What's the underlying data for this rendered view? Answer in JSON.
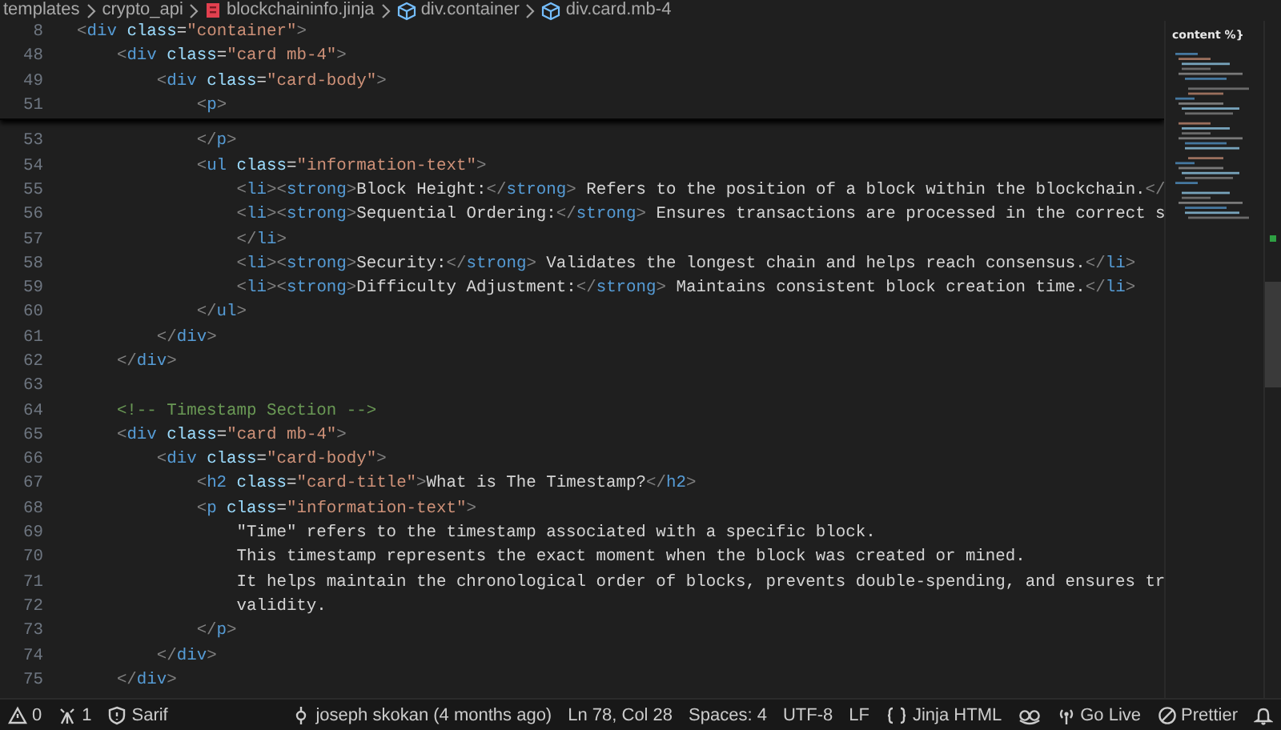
{
  "breadcrumbs": [
    {
      "text": "templates"
    },
    {
      "text": "crypto_api"
    },
    {
      "text": "blockchaininfo.jinja"
    },
    {
      "text": "div.container"
    },
    {
      "text": "div.card.mb-4"
    }
  ],
  "sticky_lines": [
    {
      "number": "8",
      "tokens": [
        {
          "kind": "punct",
          "text": "<"
        },
        {
          "kind": "tag",
          "text": "div"
        },
        {
          "kind": "attr",
          "text": " class"
        },
        {
          "kind": "op",
          "text": "="
        },
        {
          "kind": "str",
          "text": "\"container\""
        },
        {
          "kind": "punct",
          "text": ">"
        }
      ]
    },
    {
      "number": "48",
      "tokens": [
        {
          "kind": "punct",
          "text": "    <"
        },
        {
          "kind": "tag",
          "text": "div"
        },
        {
          "kind": "attr",
          "text": " class"
        },
        {
          "kind": "op",
          "text": "="
        },
        {
          "kind": "str",
          "text": "\"card mb-4\""
        },
        {
          "kind": "punct",
          "text": ">"
        }
      ]
    },
    {
      "number": "49",
      "tokens": [
        {
          "kind": "punct",
          "text": "        <"
        },
        {
          "kind": "tag",
          "text": "div"
        },
        {
          "kind": "attr",
          "text": " class"
        },
        {
          "kind": "op",
          "text": "="
        },
        {
          "kind": "str",
          "text": "\"card-body\""
        },
        {
          "kind": "punct",
          "text": ">"
        }
      ]
    },
    {
      "number": "51",
      "tokens": [
        {
          "kind": "punct",
          "text": "            <"
        },
        {
          "kind": "tag",
          "text": "p"
        },
        {
          "kind": "punct",
          "text": ">"
        }
      ]
    }
  ],
  "lines": [
    {
      "number": "53",
      "tokens": [
        {
          "kind": "punct",
          "text": "            </"
        },
        {
          "kind": "tag",
          "text": "p"
        },
        {
          "kind": "punct",
          "text": ">"
        }
      ]
    },
    {
      "number": "54",
      "tokens": [
        {
          "kind": "punct",
          "text": "            <"
        },
        {
          "kind": "tag",
          "text": "ul"
        },
        {
          "kind": "attr",
          "text": " class"
        },
        {
          "kind": "op",
          "text": "="
        },
        {
          "kind": "str",
          "text": "\"information-text\""
        },
        {
          "kind": "punct",
          "text": ">"
        }
      ]
    },
    {
      "number": "55",
      "tokens": [
        {
          "kind": "punct",
          "text": "                <"
        },
        {
          "kind": "tag",
          "text": "li"
        },
        {
          "kind": "punct",
          "text": "><"
        },
        {
          "kind": "tag",
          "text": "strong"
        },
        {
          "kind": "punct",
          "text": ">"
        },
        {
          "kind": "text",
          "text": "Block Height:"
        },
        {
          "kind": "punct",
          "text": "</"
        },
        {
          "kind": "tag",
          "text": "strong"
        },
        {
          "kind": "punct",
          "text": ">"
        },
        {
          "kind": "text",
          "text": " Refers to the position of a block within the blockchain."
        },
        {
          "kind": "punct",
          "text": "</"
        }
      ]
    },
    {
      "number": "56",
      "tokens": [
        {
          "kind": "punct",
          "text": "                <"
        },
        {
          "kind": "tag",
          "text": "li"
        },
        {
          "kind": "punct",
          "text": "><"
        },
        {
          "kind": "tag",
          "text": "strong"
        },
        {
          "kind": "punct",
          "text": ">"
        },
        {
          "kind": "text",
          "text": "Sequential Ordering:"
        },
        {
          "kind": "punct",
          "text": "</"
        },
        {
          "kind": "tag",
          "text": "strong"
        },
        {
          "kind": "punct",
          "text": ">"
        },
        {
          "kind": "text",
          "text": " Ensures transactions are processed in the correct s"
        }
      ]
    },
    {
      "number": "57",
      "tokens": [
        {
          "kind": "punct",
          "text": "                </"
        },
        {
          "kind": "tag",
          "text": "li"
        },
        {
          "kind": "punct",
          "text": ">"
        }
      ]
    },
    {
      "number": "58",
      "tokens": [
        {
          "kind": "punct",
          "text": "                <"
        },
        {
          "kind": "tag",
          "text": "li"
        },
        {
          "kind": "punct",
          "text": "><"
        },
        {
          "kind": "tag",
          "text": "strong"
        },
        {
          "kind": "punct",
          "text": ">"
        },
        {
          "kind": "text",
          "text": "Security:"
        },
        {
          "kind": "punct",
          "text": "</"
        },
        {
          "kind": "tag",
          "text": "strong"
        },
        {
          "kind": "punct",
          "text": ">"
        },
        {
          "kind": "text",
          "text": " Validates the longest chain and helps reach consensus."
        },
        {
          "kind": "punct",
          "text": "</"
        },
        {
          "kind": "tag",
          "text": "li"
        },
        {
          "kind": "punct",
          "text": ">"
        }
      ]
    },
    {
      "number": "59",
      "tokens": [
        {
          "kind": "punct",
          "text": "                <"
        },
        {
          "kind": "tag",
          "text": "li"
        },
        {
          "kind": "punct",
          "text": "><"
        },
        {
          "kind": "tag",
          "text": "strong"
        },
        {
          "kind": "punct",
          "text": ">"
        },
        {
          "kind": "text",
          "text": "Difficulty Adjustment:"
        },
        {
          "kind": "punct",
          "text": "</"
        },
        {
          "kind": "tag",
          "text": "strong"
        },
        {
          "kind": "punct",
          "text": ">"
        },
        {
          "kind": "text",
          "text": " Maintains consistent block creation time."
        },
        {
          "kind": "punct",
          "text": "</"
        },
        {
          "kind": "tag",
          "text": "li"
        },
        {
          "kind": "punct",
          "text": ">"
        }
      ]
    },
    {
      "number": "60",
      "tokens": [
        {
          "kind": "punct",
          "text": "            </"
        },
        {
          "kind": "tag",
          "text": "ul"
        },
        {
          "kind": "punct",
          "text": ">"
        }
      ]
    },
    {
      "number": "61",
      "tokens": [
        {
          "kind": "punct",
          "text": "        </"
        },
        {
          "kind": "tag",
          "text": "div"
        },
        {
          "kind": "punct",
          "text": ">"
        }
      ]
    },
    {
      "number": "62",
      "tokens": [
        {
          "kind": "punct",
          "text": "    </"
        },
        {
          "kind": "tag",
          "text": "div"
        },
        {
          "kind": "punct",
          "text": ">"
        }
      ]
    },
    {
      "number": "63"
    },
    {
      "number": "64",
      "tokens": [
        {
          "kind": "comment",
          "text": "    <!-- Timestamp Section -->"
        }
      ]
    },
    {
      "number": "65",
      "tokens": [
        {
          "kind": "punct",
          "text": "    <"
        },
        {
          "kind": "tag",
          "text": "div"
        },
        {
          "kind": "attr",
          "text": " class"
        },
        {
          "kind": "op",
          "text": "="
        },
        {
          "kind": "str",
          "text": "\"card mb-4\""
        },
        {
          "kind": "punct",
          "text": ">"
        }
      ]
    },
    {
      "number": "66",
      "tokens": [
        {
          "kind": "punct",
          "text": "        <"
        },
        {
          "kind": "tag",
          "text": "div"
        },
        {
          "kind": "attr",
          "text": " class"
        },
        {
          "kind": "op",
          "text": "="
        },
        {
          "kind": "str",
          "text": "\"card-body\""
        },
        {
          "kind": "punct",
          "text": ">"
        }
      ]
    },
    {
      "number": "67",
      "tokens": [
        {
          "kind": "punct",
          "text": "            <"
        },
        {
          "kind": "tag",
          "text": "h2"
        },
        {
          "kind": "attr",
          "text": " class"
        },
        {
          "kind": "op",
          "text": "="
        },
        {
          "kind": "str",
          "text": "\"card-title\""
        },
        {
          "kind": "punct",
          "text": ">"
        },
        {
          "kind": "text",
          "text": "What is The Timestamp?"
        },
        {
          "kind": "punct",
          "text": "</"
        },
        {
          "kind": "tag",
          "text": "h2"
        },
        {
          "kind": "punct",
          "text": ">"
        }
      ]
    },
    {
      "number": "68",
      "tokens": [
        {
          "kind": "punct",
          "text": "            <"
        },
        {
          "kind": "tag",
          "text": "p"
        },
        {
          "kind": "attr",
          "text": " class"
        },
        {
          "kind": "op",
          "text": "="
        },
        {
          "kind": "str",
          "text": "\"information-text\""
        },
        {
          "kind": "punct",
          "text": ">"
        }
      ]
    },
    {
      "number": "69",
      "tokens": [
        {
          "kind": "text",
          "text": "                \"Time\" refers to the timestamp associated with a specific block."
        }
      ]
    },
    {
      "number": "70",
      "tokens": [
        {
          "kind": "text",
          "text": "                This timestamp represents the exact moment when the block was created or mined."
        }
      ]
    },
    {
      "number": "71",
      "tokens": [
        {
          "kind": "text",
          "text": "                It helps maintain the chronological order of blocks, prevents double-spending, and ensures tr"
        }
      ]
    },
    {
      "number": "72",
      "tokens": [
        {
          "kind": "text",
          "text": "                validity."
        }
      ]
    },
    {
      "number": "73",
      "tokens": [
        {
          "kind": "punct",
          "text": "            </"
        },
        {
          "kind": "tag",
          "text": "p"
        },
        {
          "kind": "punct",
          "text": ">"
        }
      ]
    },
    {
      "number": "74",
      "tokens": [
        {
          "kind": "punct",
          "text": "        </"
        },
        {
          "kind": "tag",
          "text": "div"
        },
        {
          "kind": "punct",
          "text": ">"
        }
      ]
    },
    {
      "number": "75",
      "tokens": [
        {
          "kind": "punct",
          "text": "    </"
        },
        {
          "kind": "tag",
          "text": "div"
        },
        {
          "kind": "punct",
          "text": ">"
        }
      ]
    }
  ],
  "minimap": {
    "heading": "content %}"
  },
  "status_bar": {
    "left": [
      {
        "text": "0"
      },
      {
        "text": "1"
      },
      {
        "text": "Sarif"
      }
    ],
    "right": [
      {
        "text": "joseph skokan (4 months ago)"
      },
      {
        "text": "Ln 78, Col 28"
      },
      {
        "text": "Spaces: 4"
      },
      {
        "text": "UTF-8"
      },
      {
        "text": "LF"
      },
      {
        "text": "Jinja HTML"
      },
      {
        "text": "Go Live"
      },
      {
        "text": "Prettier"
      }
    ]
  }
}
